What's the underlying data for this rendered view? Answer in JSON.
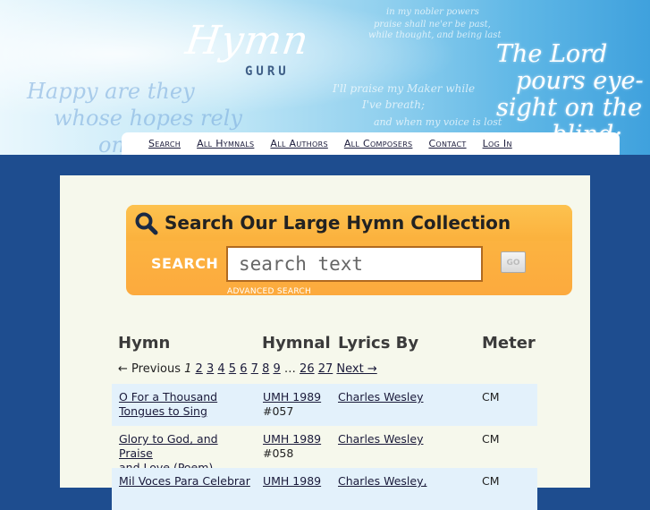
{
  "header": {
    "logo_script": "Hymn",
    "logo_sub": "GURU",
    "quote_lines": [
      "The Lord",
      "pours eye-",
      "sight on the",
      "blind;"
    ],
    "bg_lines": [
      "Happy are they",
      "whose hopes rely",
      "on G",
      "I'll praise my Maker while",
      "I've breath;",
      "and when my voice is lost",
      "in my nobler powers",
      "praise shall ne'er be past,",
      "while thought, and being last"
    ]
  },
  "nav": [
    "Search",
    "All Hymnals",
    "All Authors",
    "All Composers",
    "Contact",
    "Log In"
  ],
  "search": {
    "title": "Search Our Large Hymn Collection",
    "label": "SEARCH",
    "placeholder": "search text",
    "go_label": "GO",
    "advanced_label": "ADVANCED SEARCH"
  },
  "table": {
    "headers": [
      "Hymn",
      "Hymnal",
      "Lyrics By",
      "Meter"
    ],
    "pager": {
      "prev": "← Previous",
      "current": "1",
      "pages": [
        "2",
        "3",
        "4",
        "5",
        "6",
        "7",
        "8",
        "9"
      ],
      "ellipsis": "…",
      "last_pages": [
        "26",
        "27"
      ],
      "next": "Next →"
    },
    "rows": [
      {
        "hymn_line1": "O For a Thousand",
        "hymn_line2": "Tongues to Sing",
        "hymnal": "UMH 1989",
        "number": "#057",
        "lyrics": "Charles Wesley",
        "meter": "CM"
      },
      {
        "hymn_line1": "Glory to God, and Praise",
        "hymn_line2": "and Love (Poem)",
        "hymnal": "UMH 1989",
        "number": "#058",
        "lyrics": "Charles Wesley",
        "meter": "CM"
      },
      {
        "hymn_line1": "Mil Voces Para Celebrar",
        "hymn_line2": "",
        "hymnal": "UMH 1989",
        "number": "",
        "lyrics": "Charles Wesley,",
        "meter": "CM"
      }
    ]
  },
  "colors": {
    "page_bg": "#1e4d8f",
    "panel_bg": "#f6f8ec",
    "search_orange": "#fcb340",
    "row_alt": "#e3f1fb",
    "link": "#1a1a3a"
  },
  "icons": {
    "search": "magnifier-icon"
  }
}
